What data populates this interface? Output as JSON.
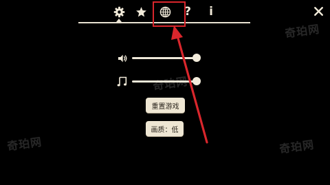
{
  "toolbar": {
    "tabs": [
      {
        "name": "settings",
        "icon": "gear-icon",
        "selected": true
      },
      {
        "name": "favorites",
        "icon": "star-icon",
        "selected": false
      },
      {
        "name": "language",
        "icon": "globe-icon",
        "selected": false
      },
      {
        "name": "help",
        "icon": "question-icon",
        "label": "?",
        "selected": false
      },
      {
        "name": "info",
        "icon": "info-icon",
        "label": "i",
        "selected": false
      }
    ],
    "close_icon": "close-icon"
  },
  "settings": {
    "sound": {
      "icon": "speaker-icon",
      "level": 1.0
    },
    "music": {
      "icon": "music-note-icon",
      "level": 1.0
    },
    "reset_label": "重置游戏",
    "quality_label": "画质：低"
  },
  "annotation": {
    "highlight_target": "language",
    "color": "#d9262c"
  },
  "watermark": {
    "text": "奇珀网"
  },
  "colors": {
    "background": "#000000",
    "foreground": "#f1ead9",
    "button_bg": "#eee6d3",
    "button_text": "#2a241c",
    "annotation": "#d9262c"
  }
}
